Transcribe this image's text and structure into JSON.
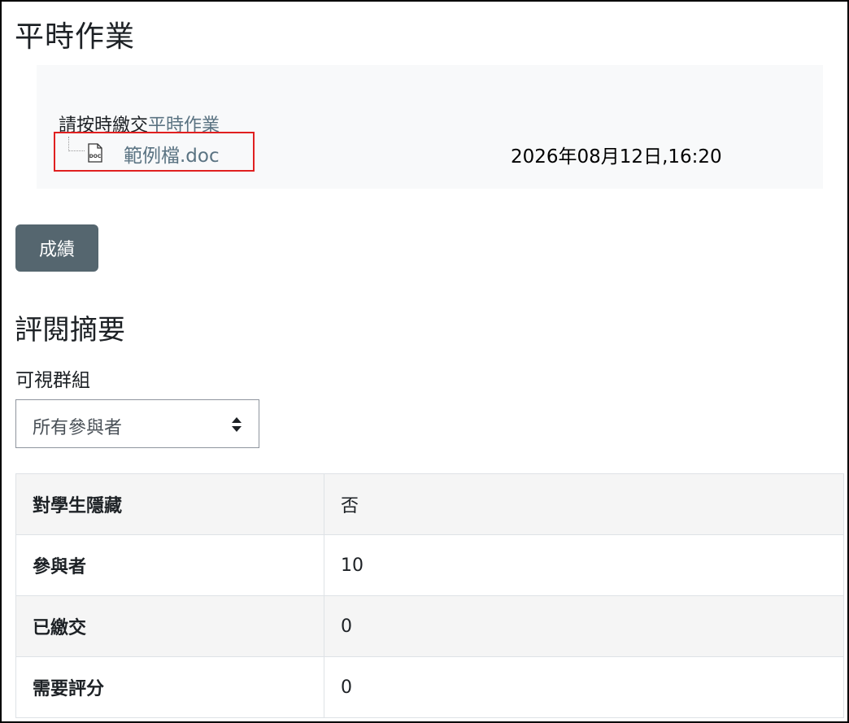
{
  "page": {
    "title": "平時作業"
  },
  "intro": {
    "text": "請按時繳交",
    "link_text": "平時作業",
    "file": {
      "icon": "doc-file-icon",
      "icon_label": "DOC",
      "name": "範例檔.doc",
      "date": "2026年08月12日,16:20"
    }
  },
  "actions": {
    "grade_button_label": "成績"
  },
  "summary": {
    "title": "評閱摘要",
    "group_label": "可視群組",
    "group_selected": "所有參與者",
    "rows": [
      {
        "label": "對學生隱藏",
        "value": "否"
      },
      {
        "label": "參與者",
        "value": "10"
      },
      {
        "label": "已繳交",
        "value": "0"
      },
      {
        "label": "需要評分",
        "value": "0"
      }
    ]
  },
  "colors": {
    "link": "#5a7382",
    "button_bg": "#55666f",
    "highlight_border": "#e02020",
    "intro_bg": "#f8f9fa"
  }
}
